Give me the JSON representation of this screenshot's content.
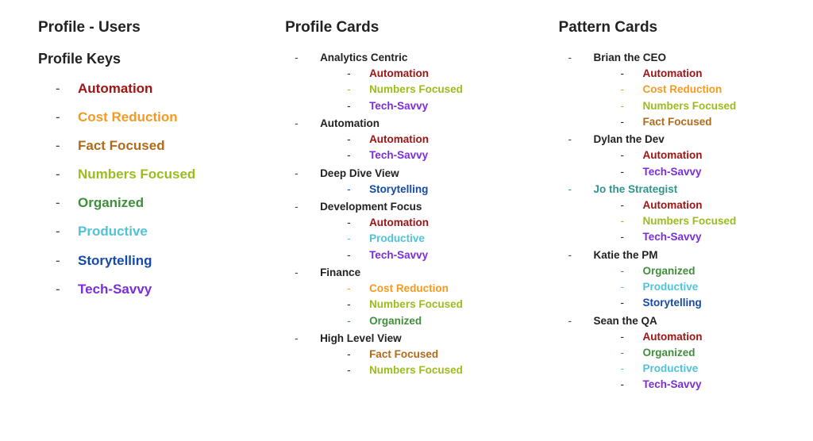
{
  "left": {
    "title": "Profile - Users",
    "section": "Profile Keys",
    "keys": [
      {
        "label": "Automation",
        "cls": "c-automation"
      },
      {
        "label": "Cost Reduction",
        "cls": "c-cost-reduction"
      },
      {
        "label": "Fact Focused",
        "cls": "c-fact-focused"
      },
      {
        "label": "Numbers Focused",
        "cls": "c-numbers-focused"
      },
      {
        "label": "Organized",
        "cls": "c-organized"
      },
      {
        "label": "Productive",
        "cls": "c-productive"
      },
      {
        "label": "Storytelling",
        "cls": "c-storytelling"
      },
      {
        "label": "Tech-Savvy",
        "cls": "c-tech-savvy"
      }
    ]
  },
  "mid": {
    "title": "Profile Cards",
    "cards": [
      {
        "name": "Analytics Centric",
        "tags": [
          {
            "label": "Automation",
            "cls": "c-automation"
          },
          {
            "label": "Numbers Focused",
            "cls": "c-numbers-focused",
            "dash": "dash-numbers"
          },
          {
            "label": "Tech-Savvy",
            "cls": "c-tech-savvy"
          }
        ]
      },
      {
        "name": "Automation",
        "tags": [
          {
            "label": "Automation",
            "cls": "c-automation"
          },
          {
            "label": "Tech-Savvy",
            "cls": "c-tech-savvy"
          }
        ]
      },
      {
        "name": "Deep Dive View",
        "tags": [
          {
            "label": "Storytelling",
            "cls": "c-storytelling",
            "dash": "dash-storytelling"
          }
        ]
      },
      {
        "name": "Development Focus",
        "tags": [
          {
            "label": "Automation",
            "cls": "c-automation"
          },
          {
            "label": "Productive",
            "cls": "c-productive",
            "dash": "dash-productive"
          },
          {
            "label": "Tech-Savvy",
            "cls": "c-tech-savvy"
          }
        ]
      },
      {
        "name": "Finance",
        "tags": [
          {
            "label": "Cost Reduction",
            "cls": "c-cost-reduction",
            "dash": "dash-cost"
          },
          {
            "label": "Numbers Focused",
            "cls": "c-numbers-focused"
          },
          {
            "label": "Organized",
            "cls": "c-organized",
            "dash": "dash-organized"
          }
        ]
      },
      {
        "name": "High Level View",
        "tags": [
          {
            "label": "Fact Focused",
            "cls": "c-fact-focused"
          },
          {
            "label": "Numbers Focused",
            "cls": "c-numbers-focused"
          }
        ]
      }
    ]
  },
  "right": {
    "title": "Pattern Cards",
    "cards": [
      {
        "name": "Brian the CEO",
        "tags": [
          {
            "label": "Automation",
            "cls": "c-automation"
          },
          {
            "label": "Cost Reduction",
            "cls": "c-cost-reduction",
            "dash": "dash-cost"
          },
          {
            "label": "Numbers Focused",
            "cls": "c-numbers-focused",
            "dash": "dash-numbers"
          },
          {
            "label": "Fact Focused",
            "cls": "c-fact-focused"
          }
        ]
      },
      {
        "name": "Dylan the Dev",
        "tags": [
          {
            "label": "Automation",
            "cls": "c-automation"
          },
          {
            "label": "Tech-Savvy",
            "cls": "c-tech-savvy"
          }
        ]
      },
      {
        "name": "Jo the Strategist",
        "cls": "c-jo",
        "dash": "dash-jo",
        "tags": [
          {
            "label": "Automation",
            "cls": "c-automation"
          },
          {
            "label": "Numbers Focused",
            "cls": "c-numbers-focused",
            "dash": "dash-numbers"
          },
          {
            "label": "Tech-Savvy",
            "cls": "c-tech-savvy"
          }
        ]
      },
      {
        "name": "Katie the PM",
        "tags": [
          {
            "label": "Organized",
            "cls": "c-organized",
            "dash": "dash-organized"
          },
          {
            "label": "Productive",
            "cls": "c-productive",
            "dash": "dash-productive"
          },
          {
            "label": "Storytelling",
            "cls": "c-storytelling"
          }
        ]
      },
      {
        "name": "Sean the QA",
        "tags": [
          {
            "label": "Automation",
            "cls": "c-automation"
          },
          {
            "label": "Organized",
            "cls": "c-organized",
            "dash": "dash-organized"
          },
          {
            "label": "Productive",
            "cls": "c-productive",
            "dash": "dash-productive"
          },
          {
            "label": "Tech-Savvy",
            "cls": "c-tech-savvy"
          }
        ]
      }
    ]
  }
}
